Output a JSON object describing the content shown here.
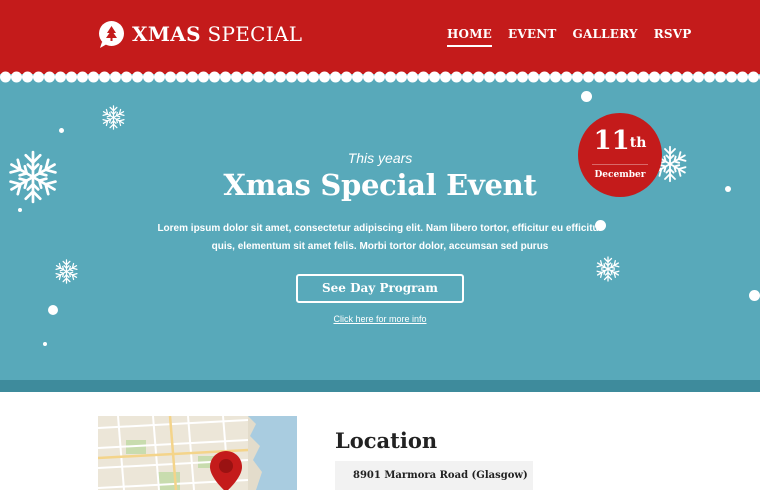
{
  "header": {
    "logo_bold": "XMAS",
    "logo_light": "SPECIAL",
    "nav": [
      "HOME",
      "EVENT",
      "GALLERY",
      "RSVP"
    ],
    "active_nav": "HOME"
  },
  "hero": {
    "pre_title": "This years",
    "title": "Xmas Special Event",
    "description": "Lorem ipsum dolor sit amet, consectetur adipiscing elit. Nam libero tortor, efficitur eu efficitur quis, elementum sit amet felis. Morbi tortor dolor, accumsan sed purus",
    "cta": "See Day Program",
    "more_link": "Click here for more info"
  },
  "date_badge": {
    "day": "11",
    "suffix": "th",
    "month": "December"
  },
  "location": {
    "title": "Location",
    "address": "8901 Marmora Road (Glasgow)"
  },
  "colors": {
    "brand_red": "#c41b1b",
    "hero_teal": "#58a9ba",
    "hero_teal_dark": "#3e8b9c"
  },
  "icons": [
    "tree-bubble-icon",
    "snowflake-icon",
    "map-pin-icon"
  ]
}
